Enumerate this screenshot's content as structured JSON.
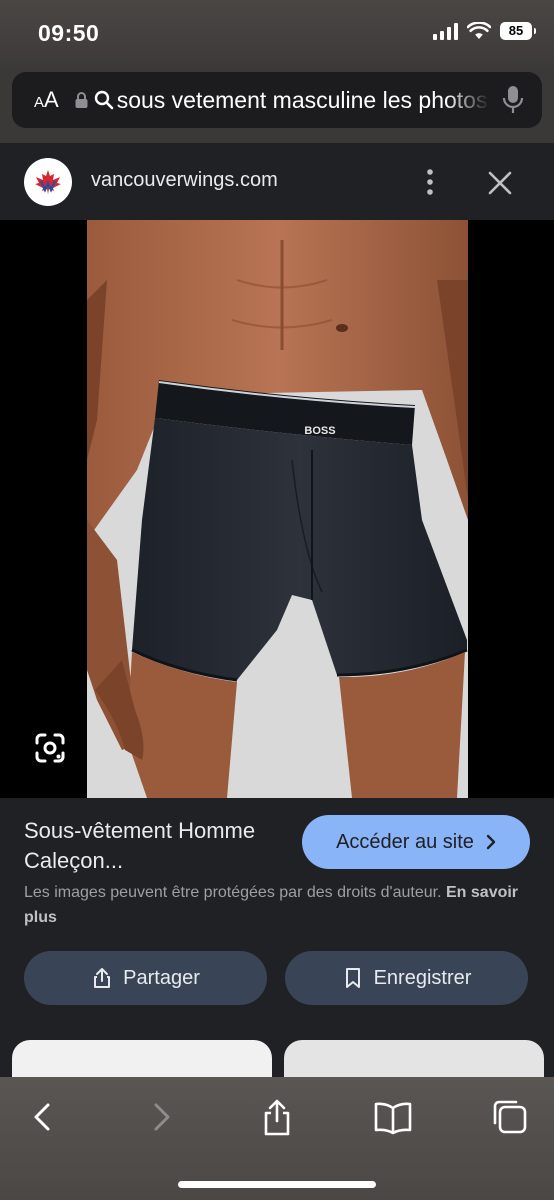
{
  "status_bar": {
    "time": "09:50",
    "battery": "85",
    "icons": [
      "signal-icon",
      "wifi-icon",
      "battery-icon"
    ]
  },
  "browser": {
    "text_size_label": "AA",
    "url_text": "sous vetement masculine les photos",
    "icons": [
      "lock-icon",
      "search-icon",
      "microphone-icon"
    ]
  },
  "site": {
    "domain": "vancouverwings.com",
    "icons": [
      "more-vert-icon",
      "close-icon"
    ]
  },
  "image": {
    "brand_text": "BOSS",
    "lens_icon": "google-lens-icon"
  },
  "result": {
    "title": "Sous-vêtement Homme Caleçon...",
    "visit_label": "Accéder au site",
    "copyright_text": "Les images peuvent être protégées par des droits d'auteur.",
    "learn_more": "En savoir plus"
  },
  "actions": {
    "share_label": "Partager",
    "save_label": "Enregistrer"
  },
  "toolbar": {
    "icons": [
      "back-icon",
      "forward-icon",
      "share-icon",
      "bookmarks-icon",
      "tabs-icon"
    ]
  },
  "colors": {
    "accent": "#8ab4f8",
    "button_bg": "#394457",
    "page_bg": "#202124"
  }
}
